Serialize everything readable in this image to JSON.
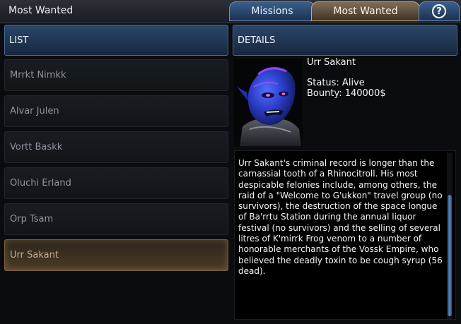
{
  "window": {
    "title": "Most Wanted"
  },
  "tabs": [
    {
      "label": "Missions",
      "active": false
    },
    {
      "label": "Most Wanted",
      "active": true
    },
    {
      "label": "?",
      "icon": "help-icon",
      "active": false
    }
  ],
  "list": {
    "header": "LIST",
    "items": [
      {
        "label": "Mrrkt Nimkk",
        "selected": false
      },
      {
        "label": "Alvar Julen",
        "selected": false
      },
      {
        "label": "Vortt Baskk",
        "selected": false
      },
      {
        "label": "Oluchi Erland",
        "selected": false
      },
      {
        "label": "Orp Tsam",
        "selected": false
      },
      {
        "label": "Urr Sakant",
        "selected": true
      }
    ]
  },
  "details": {
    "header": "DETAILS",
    "name": "Urr Sakant",
    "status_line": "Status: Alive",
    "bounty_line": "Bounty: 140000$",
    "portrait_icon": "alien-portrait",
    "description": "Urr Sakant's criminal record is longer than the carnassial tooth of a Rhinocitroll. His most despicable felonies include, among others, the raid of a \"Welcome to G'ukkon\" travel group (no survivors), the destruction of the space longue of Ba'rrtu Station during the annual liquor festival (no survivors) and the selling of several litres of K'mirrk Frog venom to a number of honorable merchants of the Vossk Empire, who believed the deadly toxin to be cough syrup (56 dead)."
  },
  "colors": {
    "tab_blue": "#2a4668",
    "tab_active_gold": "#806e57",
    "selected_item": "#4b3b27",
    "scroll_thumb": "#5e86bf"
  }
}
